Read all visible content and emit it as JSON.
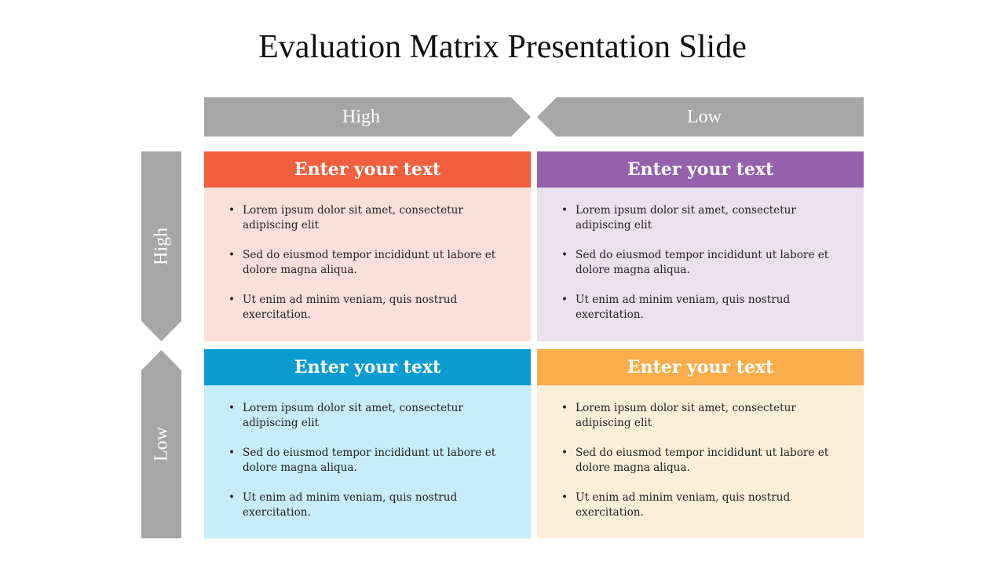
{
  "title": "Evaluation Matrix Presentation Slide",
  "top_axis": {
    "left_label": "High",
    "right_label": "Low"
  },
  "side_axis": {
    "top_label": "High",
    "bottom_label": "Low"
  },
  "quadrants": [
    {
      "heading": "Enter your text",
      "header_color": "#f25f3f",
      "body_color": "#fbdfda",
      "bullets": [
        "Lorem ipsum dolor sit amet, consectetur adipiscing elit",
        "Sed do eiusmod tempor incididunt ut labore et dolore magna aliqua.",
        "Ut enim ad minim veniam, quis nostrud exercitation."
      ]
    },
    {
      "heading": "Enter your text",
      "header_color": "#9561ac",
      "body_color": "#eae0ee",
      "bullets": [
        "Lorem ipsum dolor sit amet, consectetur adipiscing elit",
        "Sed do eiusmod tempor incididunt ut labore et dolore magna aliqua.",
        "Ut enim ad minim veniam, quis nostrud exercitation."
      ]
    },
    {
      "heading": "Enter your text",
      "header_color": "#0b9dd1",
      "body_color": "#c7ecfa",
      "bullets": [
        "Lorem ipsum dolor sit amet, consectetur adipiscing elit",
        "Sed do eiusmod tempor incididunt ut labore et dolore magna aliqua.",
        "Ut enim ad minim veniam, quis nostrud exercitation."
      ]
    },
    {
      "heading": "Enter your text",
      "header_color": "#f9ad4c",
      "body_color": "#fdeed8",
      "bullets": [
        "Lorem ipsum dolor sit amet, consectetur adipiscing elit",
        "Sed do eiusmod tempor incididunt ut labore et dolore magna aliqua.",
        "Ut enim ad minim veniam, quis nostrud exercitation."
      ]
    }
  ],
  "colors": {
    "axis_gray": "#a6a6a6"
  }
}
